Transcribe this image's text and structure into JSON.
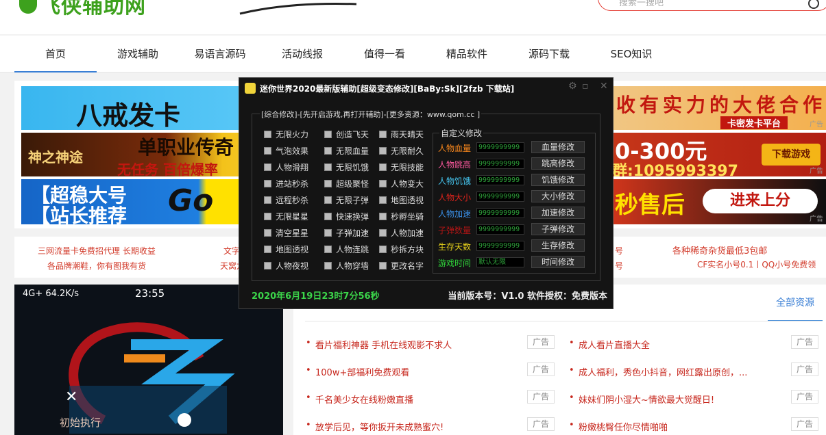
{
  "site": {
    "logo_text": "飞侠辅助网",
    "search_placeholder": "搜索一搜吧"
  },
  "nav": {
    "items": [
      {
        "label": "首页"
      },
      {
        "label": "游戏辅助"
      },
      {
        "label": "易语言源码"
      },
      {
        "label": "活动线报"
      },
      {
        "label": "值得一看"
      },
      {
        "label": "精品软件"
      },
      {
        "label": "源码下载"
      },
      {
        "label": "SEO知识"
      }
    ]
  },
  "banners": {
    "b1_left": "八戒发卡",
    "b1_right": "收有实力的大佬合作",
    "b1_sub": "卡密发卡平台",
    "b2_left": "单职业传奇",
    "b2_left_sub": "无任务 百倍爆率",
    "b2_game": "神之神途",
    "b2_right": "0-300元",
    "b2_qq": "群:1095993397",
    "b2_btn": "下载游戏",
    "b3_left1": "【超稳大号",
    "b3_left2": "【站长推荐",
    "b3_go": "Go",
    "b3_right": "秒售后",
    "b3_btn": "进来上分",
    "ad_label": "广告"
  },
  "links": {
    "l1": "三网流量卡免费招代理 长期收益",
    "l2": "各品牌潮鞋，你有图我有货",
    "l3": "文字",
    "l4": "天窝龙",
    "l5": "号",
    "l6": "号",
    "l7": "各种稀奇杂货最低3包邮",
    "l8": "CF实名小号0.1丨QQ小号免费领"
  },
  "phone": {
    "status": "4G+ 64.2K/s",
    "time": "23:55",
    "label": "初始执行"
  },
  "panel": {
    "all_resources": "全部资源",
    "ad_label": "广告",
    "left": [
      "看片福利神器 手机在线观影不求人",
      "100w+部福利免费观看",
      "千名美少女在线粉嫩直播",
      "放学后见，等你扳开未成熟蜜穴!"
    ],
    "right": [
      "成人看片直播大全",
      "成人福利，秀色小抖音，网红露出原创，...",
      "妹妹们阴小湿大~情欲最大觉醒日!",
      "粉嫩桃臀任你尽情啪啪"
    ]
  },
  "window": {
    "title": "迷你世界2020最新版辅助[超级变态修改][BaBy:Sk][2fzb 下载站]",
    "outer_legend": "[综合修改]-[先开启游戏,再打开辅助]-[更多资源：www.qom.cc      ]",
    "checkbox_cols": [
      [
        "无限火力",
        "气泡效果",
        "人物滑翔",
        "进站秒杀",
        "远程秒杀",
        "无限星星",
        "清空星星",
        "地图透视",
        "人物夜视"
      ],
      [
        "创造飞天",
        "无限血量",
        "无限饥饿",
        "超级聚怪",
        "无限子弹",
        "快速换弹",
        "子弹加速",
        "人物连跳",
        "人物穿墙"
      ],
      [
        "雨天晴天",
        "无限耐久",
        "无限技能",
        "人物变大",
        "地图透视",
        "秒孵坐骑",
        "人物加速",
        "秒拆方块",
        "更改名字"
      ]
    ],
    "inner_legend": "自定义修改",
    "mods": [
      {
        "label": "人物血量",
        "value": "9999999999",
        "button": "血量修改",
        "color": "#ff8a1c"
      },
      {
        "label": "人物跳高",
        "value": "9999999999",
        "button": "跳高修改",
        "color": "#ff5aa0"
      },
      {
        "label": "人物饥饿",
        "value": "9999999999",
        "button": "饥饿修改",
        "color": "#45c6f0"
      },
      {
        "label": "人物大小",
        "value": "9999999999",
        "button": "大小修改",
        "color": "#e0241c"
      },
      {
        "label": "人物加速",
        "value": "9999999999",
        "button": "加速修改",
        "color": "#3a8fe6"
      },
      {
        "label": "子弹数量",
        "value": "9999999999",
        "button": "子弹修改",
        "color": "#b01515"
      },
      {
        "label": "生存天数",
        "value": "9999999999",
        "button": "生存修改",
        "color": "#e8d21a"
      },
      {
        "label": "游戏时间",
        "value": "默认无限",
        "button": "时间修改",
        "color": "#2fd43a"
      }
    ],
    "datetime": "2020年6月19日23时7分56秒",
    "version": "当前版本号：V1.0 软件授权：免费版本"
  }
}
